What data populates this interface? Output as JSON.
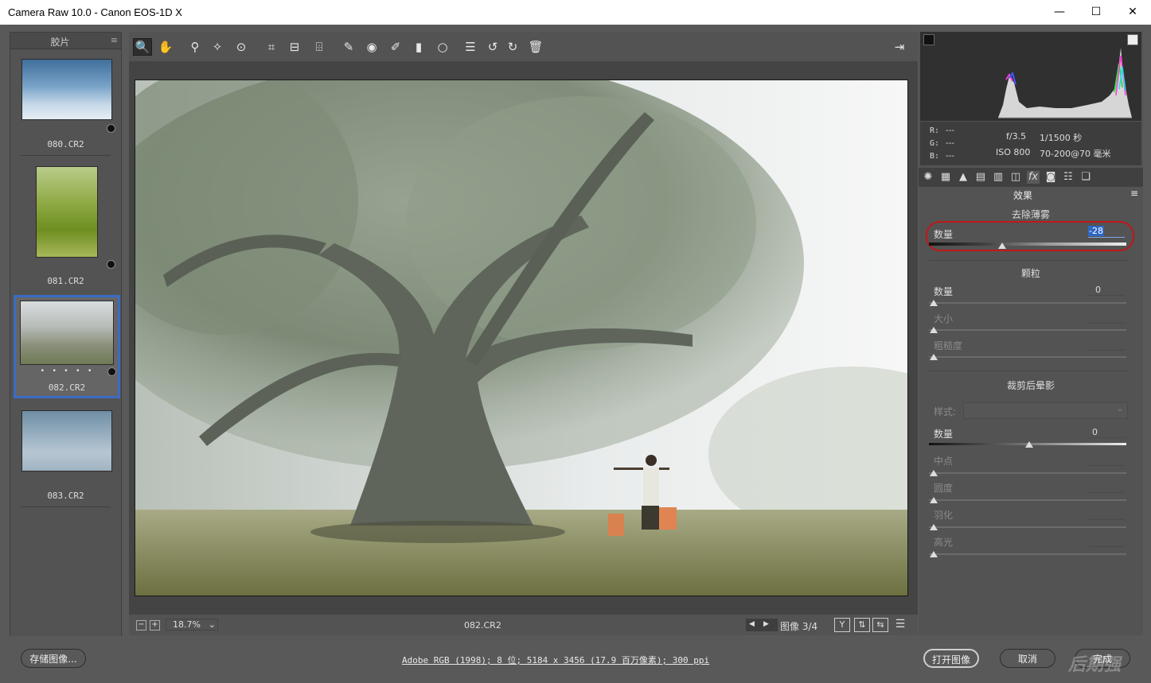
{
  "window": {
    "title": "Camera Raw 10.0 -  Canon EOS-1D X",
    "min_glyph": "—",
    "max_glyph": "☐",
    "close_glyph": "✕"
  },
  "filmstrip": {
    "header": "胶片",
    "menu_glyph": "≡",
    "items": [
      {
        "name": "080.CR2",
        "dots": ""
      },
      {
        "name": "081.CR2",
        "dots": ""
      },
      {
        "name": "082.CR2",
        "dots": "• • • • •"
      },
      {
        "name": "083.CR2",
        "dots": ""
      }
    ]
  },
  "toolbar": {
    "icons": {
      "zoom": "🔍",
      "hand": "✋",
      "white_balance": "⚲",
      "color_sampler": "✧",
      "target_adjust": "⊙",
      "crop": "⌗",
      "straighten": "⊟",
      "transform": "⌹",
      "spot_removal": "✎",
      "red_eye": "◉",
      "adjustment_brush": "✐",
      "graduated_filter": "▮",
      "radial_filter": "○",
      "preferences": "☰",
      "rotate_left": "↺",
      "rotate_right": "↻",
      "delete": "🗑",
      "fullscreen": "⇥"
    }
  },
  "status": {
    "zoom_minus": "−",
    "zoom_plus": "+",
    "zoom_value": "18.7%",
    "zoom_dropdown": "⌄",
    "filename": "082.CR2",
    "prev": "◀",
    "next": "▶",
    "image_label": "图像 3/4",
    "view_y": "Y",
    "view_swap": "⇅",
    "view_copy": "⇆",
    "view_settings": "☰"
  },
  "histogram": {
    "r_label": "R:",
    "g_label": "G:",
    "b_label": "B:",
    "r_val": "---",
    "g_val": "---",
    "b_val": "---",
    "aperture": "f/3.5",
    "shutter": "1/1500 秒",
    "iso": "ISO 800",
    "lens": "70-200@70 毫米"
  },
  "panel": {
    "title": "效果",
    "menu_glyph": "≡",
    "dehaze": {
      "section": "去除薄雾",
      "amount_label": "数量",
      "amount_value": "-28",
      "amount": -28
    },
    "grain": {
      "section": "颗粒",
      "amount_label": "数量",
      "amount_value": "0",
      "size_label": "大小",
      "roughness_label": "粗糙度"
    },
    "vignette": {
      "section": "裁剪后晕影",
      "style_label": "样式:",
      "amount_label": "数量",
      "amount_value": "0",
      "midpoint_label": "中点",
      "roundness_label": "圆度",
      "feather_label": "羽化",
      "highlights_label": "高光"
    }
  },
  "bottom": {
    "save_label": "存储图像...",
    "workflow_link": "Adobe RGB (1998); 8 位; 5184 x 3456 (17.9 百万像素); 300 ppi",
    "open_label": "打开图像",
    "cancel_label": "取消",
    "done_label": "完成",
    "watermark": "后期强"
  }
}
